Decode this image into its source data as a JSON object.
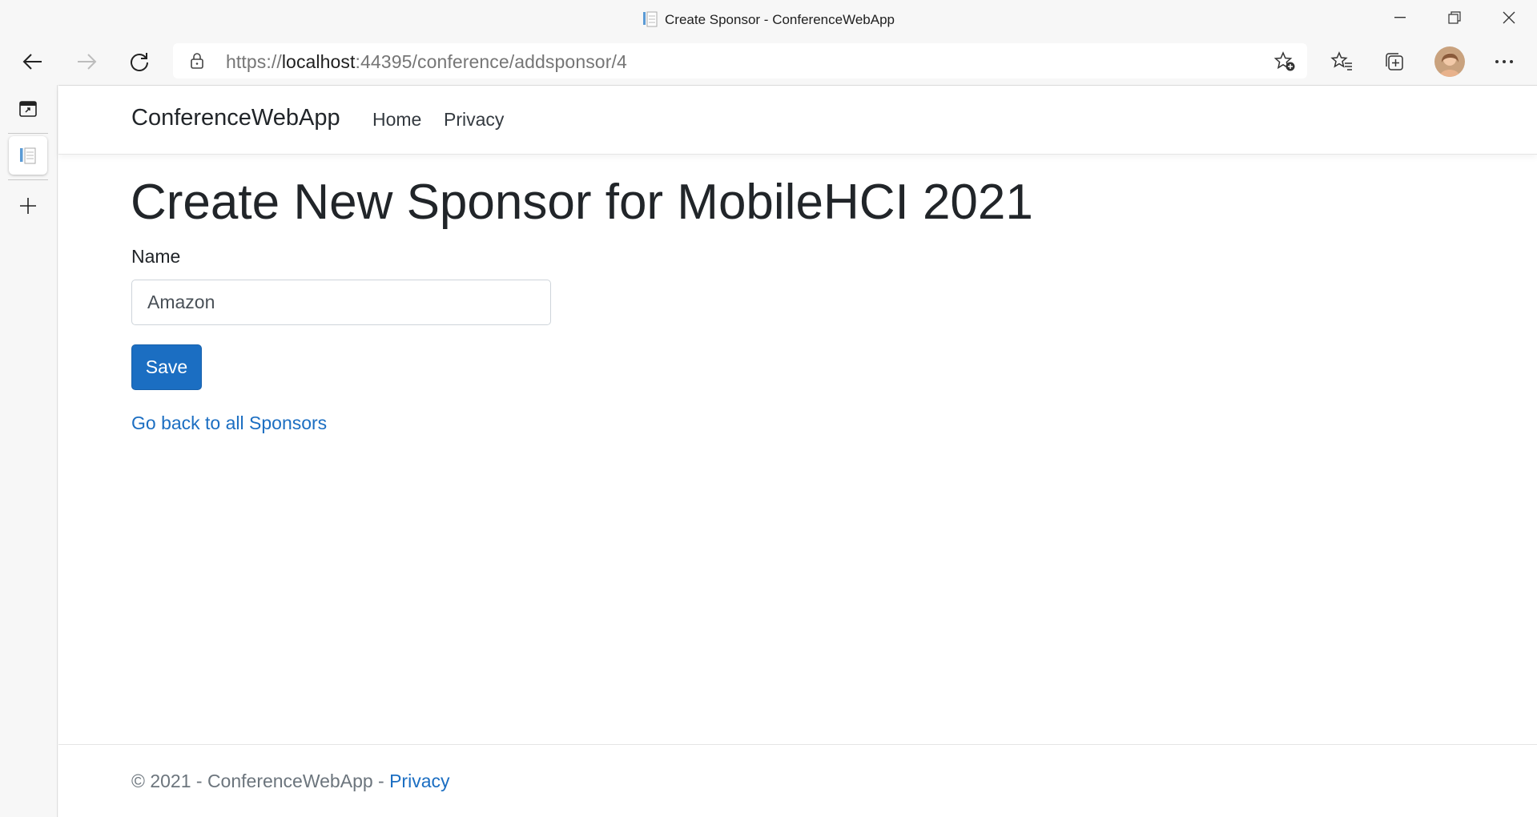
{
  "window": {
    "title": "Create Sponsor - ConferenceWebApp"
  },
  "browser": {
    "url_prefix": "https://",
    "url_host": "localhost",
    "url_rest": ":44395/conference/addsponsor/4"
  },
  "navbar": {
    "brand": "ConferenceWebApp",
    "links": [
      "Home",
      "Privacy"
    ]
  },
  "main": {
    "heading": "Create New Sponsor for MobileHCI 2021",
    "name_label": "Name",
    "name_value": "Amazon",
    "save_label": "Save",
    "back_link": "Go back to all Sponsors"
  },
  "footer": {
    "text": "© 2021 - ConferenceWebApp - ",
    "privacy_link": "Privacy"
  },
  "colors": {
    "primary": "#1b6ec2",
    "text": "#212529"
  }
}
